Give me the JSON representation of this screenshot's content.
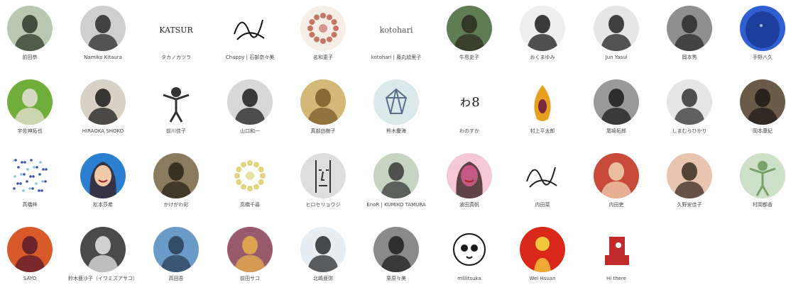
{
  "members": [
    {
      "name": "前田恭",
      "bg": "#b9c8b0",
      "fg": "#2c3a2a",
      "kind": "photo"
    },
    {
      "name": "Namiko Kitaura",
      "bg": "#cfcfcf",
      "fg": "#2a2a2a",
      "kind": "photo"
    },
    {
      "name": "タカノカツラ",
      "bg": "#ffffff",
      "fg": "#222222",
      "kind": "text-art",
      "art_text": "KATSUR"
    },
    {
      "name": "Chappy | 石部奈々美",
      "bg": "#ffffff",
      "fg": "#111111",
      "kind": "scribble"
    },
    {
      "name": "名和恵子",
      "bg": "#f4eee6",
      "fg": "#b0442c",
      "kind": "wreath"
    },
    {
      "name": "kotohari | 藤丸絵里子",
      "bg": "#ffffff",
      "fg": "#555555",
      "kind": "text-art",
      "art_text": "kotohari"
    },
    {
      "name": "牛島史子",
      "bg": "#5f7d52",
      "fg": "#2c2c20",
      "kind": "photo"
    },
    {
      "name": "おくまゆみ",
      "bg": "#eeeeee",
      "fg": "#1a1a1a",
      "kind": "photo"
    },
    {
      "name": "Jun Yasui",
      "bg": "#e6e6e6",
      "fg": "#222222",
      "kind": "photo"
    },
    {
      "name": "岡本秀",
      "bg": "#8f8f8f",
      "fg": "#2a2a2a",
      "kind": "photo"
    },
    {
      "name": "手野八久",
      "bg": "#2f5fd0",
      "fg": "#1c3f9c",
      "kind": "blob"
    },
    {
      "name": "宇佐神拓也",
      "bg": "#6fae3a",
      "fg": "#e9e2d6",
      "kind": "photo"
    },
    {
      "name": "HIRAOKA SHOKO",
      "bg": "#d9d1c6",
      "fg": "#1b1b1b",
      "kind": "photo"
    },
    {
      "name": "前川佳子",
      "bg": "#ffffff",
      "fg": "#333333",
      "kind": "figure"
    },
    {
      "name": "山口和一",
      "bg": "#d8d8d8",
      "fg": "#1d1d1d",
      "kind": "photo"
    },
    {
      "name": "真部由樹子",
      "bg": "#d4b878",
      "fg": "#7a5c2a",
      "kind": "photo"
    },
    {
      "name": "熊木慶海",
      "bg": "#dbe9ea",
      "fg": "#5c6f8a",
      "kind": "gem"
    },
    {
      "name": "わのすか",
      "bg": "#ffffff",
      "fg": "#1a1a1a",
      "kind": "text-art",
      "art_text": "ゎ8"
    },
    {
      "name": "村上平太郎",
      "bg": "#ffffff",
      "fg": "#e8a020",
      "kind": "papaya"
    },
    {
      "name": "尾崎拓郎",
      "bg": "#9a9a9a",
      "fg": "#1a1a1a",
      "kind": "photo"
    },
    {
      "name": "しまむらひかり",
      "bg": "#e6e6e6",
      "fg": "#333333",
      "kind": "photo"
    },
    {
      "name": "岡本康紀",
      "bg": "#6a5a48",
      "fg": "#1f1a15",
      "kind": "photo"
    },
    {
      "name": "高橋梓",
      "bg": "#ffffff",
      "fg": "#3a4fae",
      "kind": "dots"
    },
    {
      "name": "松本莎希",
      "bg": "#2a7fd0",
      "fg": "#f0c9a8",
      "kind": "portrait"
    },
    {
      "name": "かけがわ彩",
      "bg": "#8a7a5e",
      "fg": "#2a2418",
      "kind": "photo"
    },
    {
      "name": "高橋千尋",
      "bg": "#ffffff",
      "fg": "#d9c24a",
      "kind": "wreath"
    },
    {
      "name": "ヒロセリョウジ",
      "bg": "#dedede",
      "fg": "#333333",
      "kind": "face-line"
    },
    {
      "name": "EnoR | KUMIKO TAMURA",
      "bg": "#c6d5c2",
      "fg": "#3a3a3a",
      "kind": "photo"
    },
    {
      "name": "波田真帆",
      "bg": "#f5c8d8",
      "fg": "#c45a84",
      "kind": "portrait"
    },
    {
      "name": "内田菜",
      "bg": "#ffffff",
      "fg": "#222222",
      "kind": "scribble"
    },
    {
      "name": "内田吏",
      "bg": "#c84a3a",
      "fg": "#f0d2b2",
      "kind": "photo"
    },
    {
      "name": "久野安佳子",
      "bg": "#e7c5b1",
      "fg": "#3a2b22",
      "kind": "photo"
    },
    {
      "name": "村岡都香",
      "bg": "#cde0c8",
      "fg": "#7aa06c",
      "kind": "figure"
    },
    {
      "name": "SAYO",
      "bg": "#d85a2a",
      "fg": "#5a1a2a",
      "kind": "photo"
    },
    {
      "name": "鈴木亜沙子（イワミズアサコ）",
      "bg": "#4a4a4a",
      "fg": "#e6e6e6",
      "kind": "photo"
    },
    {
      "name": "高田吾",
      "bg": "#6a9ac8",
      "fg": "#2c3e58",
      "kind": "photo"
    },
    {
      "name": "前田サコ",
      "bg": "#9a5a6e",
      "fg": "#e8b04a",
      "kind": "photo"
    },
    {
      "name": "北嶋亜弥",
      "bg": "#e6edf3",
      "fg": "#2a2a2a",
      "kind": "photo"
    },
    {
      "name": "栗原々美",
      "bg": "#8a8a8a",
      "fg": "#1e1e1e",
      "kind": "photo"
    },
    {
      "name": "millitsuka",
      "bg": "#ffffff",
      "fg": "#1a1a1a",
      "kind": "lemur"
    },
    {
      "name": "Wei Hsuan",
      "bg": "#d8281a",
      "fg": "#f3c93a",
      "kind": "sun"
    },
    {
      "name": "Hi there",
      "bg": "#ffffff",
      "fg": "#c02a2a",
      "kind": "bust"
    }
  ]
}
